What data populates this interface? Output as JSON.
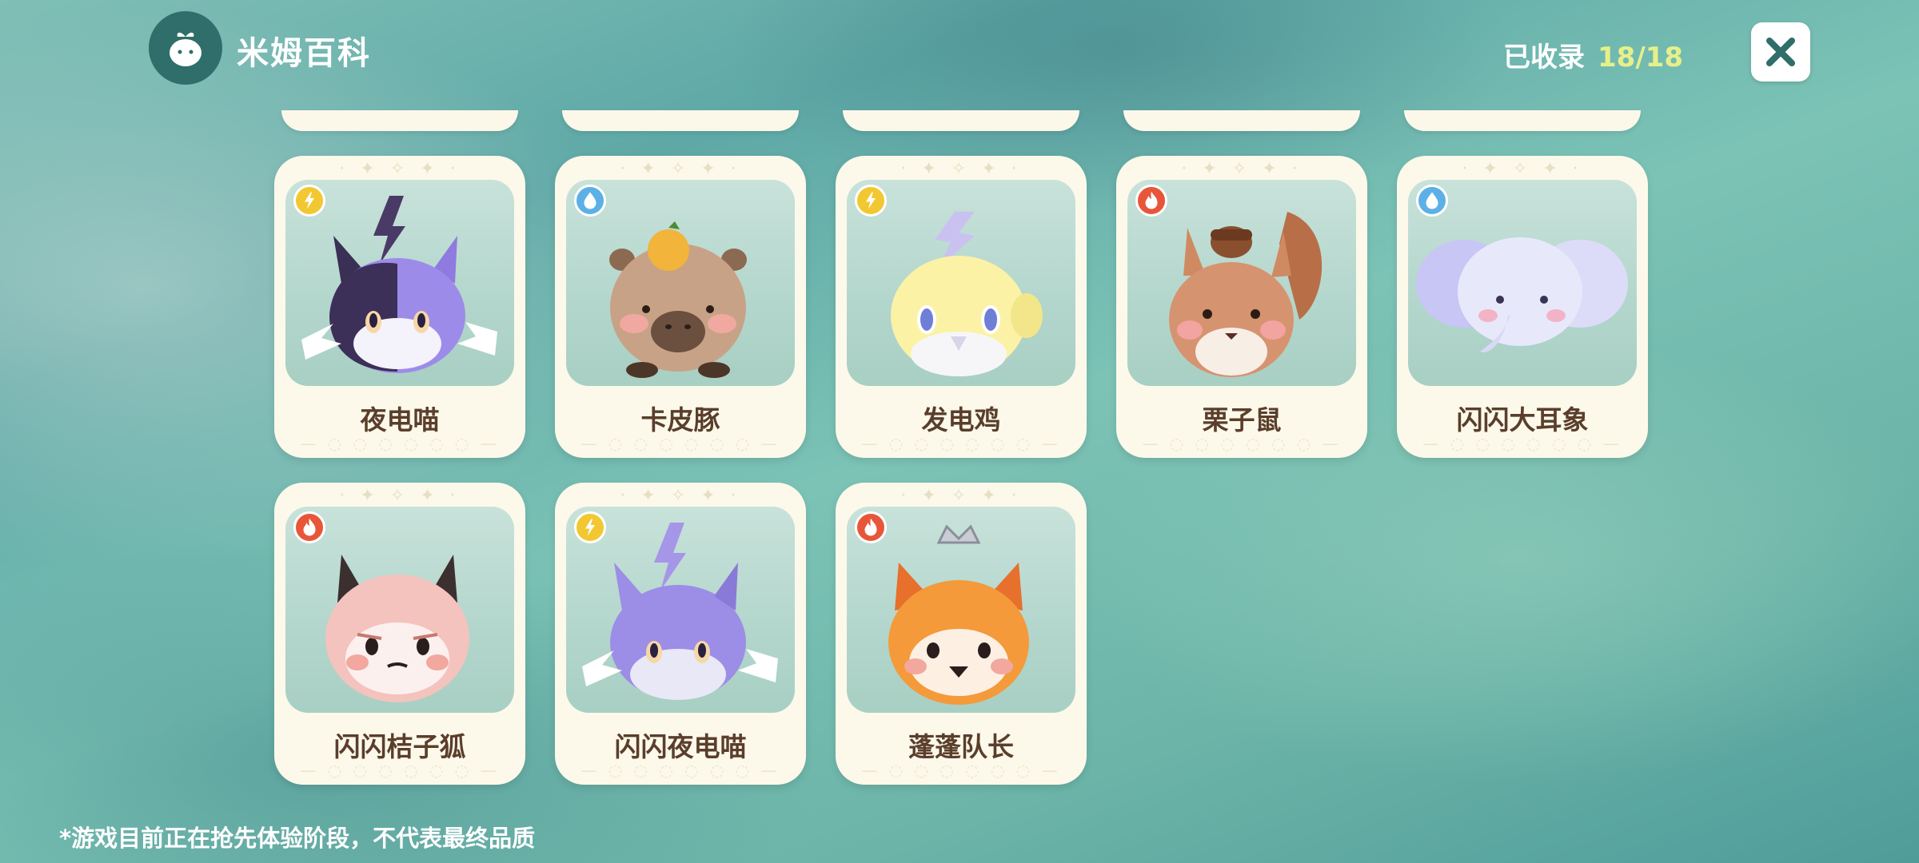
{
  "header": {
    "logo_icon": "sprout-seed-icon",
    "title": "米姆百科",
    "collected_label": "已收录",
    "collected_count": "18/18",
    "close_icon": "close-icon"
  },
  "cards": [
    {
      "name": "夜电喵",
      "element": "electric"
    },
    {
      "name": "卡皮豚",
      "element": "water"
    },
    {
      "name": "发电鸡",
      "element": "electric"
    },
    {
      "name": "栗子鼠",
      "element": "fire"
    },
    {
      "name": "闪闪大耳象",
      "element": "water"
    },
    {
      "name": "闪闪桔子狐",
      "element": "fire"
    },
    {
      "name": "闪闪夜电喵",
      "element": "electric"
    },
    {
      "name": "蓬蓬队长",
      "element": "fire"
    }
  ],
  "colors": {
    "electric": "#f2c832",
    "water": "#5cb0e6",
    "fire": "#e8563a"
  },
  "footer": {
    "disclaimer": "*游戏目前正在抢先体验阶段，不代表最终品质"
  }
}
